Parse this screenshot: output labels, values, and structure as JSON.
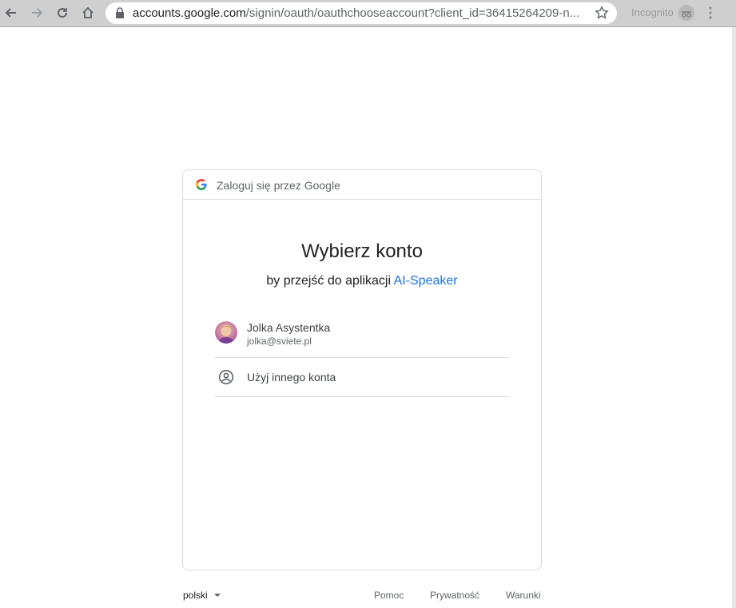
{
  "browser": {
    "url_host": "accounts.google.com",
    "url_rest": "/signin/oauth/oauthchooseaccount?client_id=36415264209-n...",
    "incognito_label": "Incognito"
  },
  "card": {
    "header_text": "Zaloguj się przez Google",
    "title": "Wybierz konto",
    "subtitle_prefix": "by przejść do aplikacji",
    "app_name": "AI-Speaker",
    "accounts": [
      {
        "name": "Jolka Asystentka",
        "email": "jolka@sviete.pl"
      }
    ],
    "use_other_label": "Użyj innego konta"
  },
  "footer": {
    "language": "polski",
    "links": [
      "Pomoc",
      "Prywatność",
      "Warunki"
    ]
  },
  "colors": {
    "link_blue": "#1a73e8",
    "border": "#dadce0",
    "secondary_text": "#5f6368"
  }
}
